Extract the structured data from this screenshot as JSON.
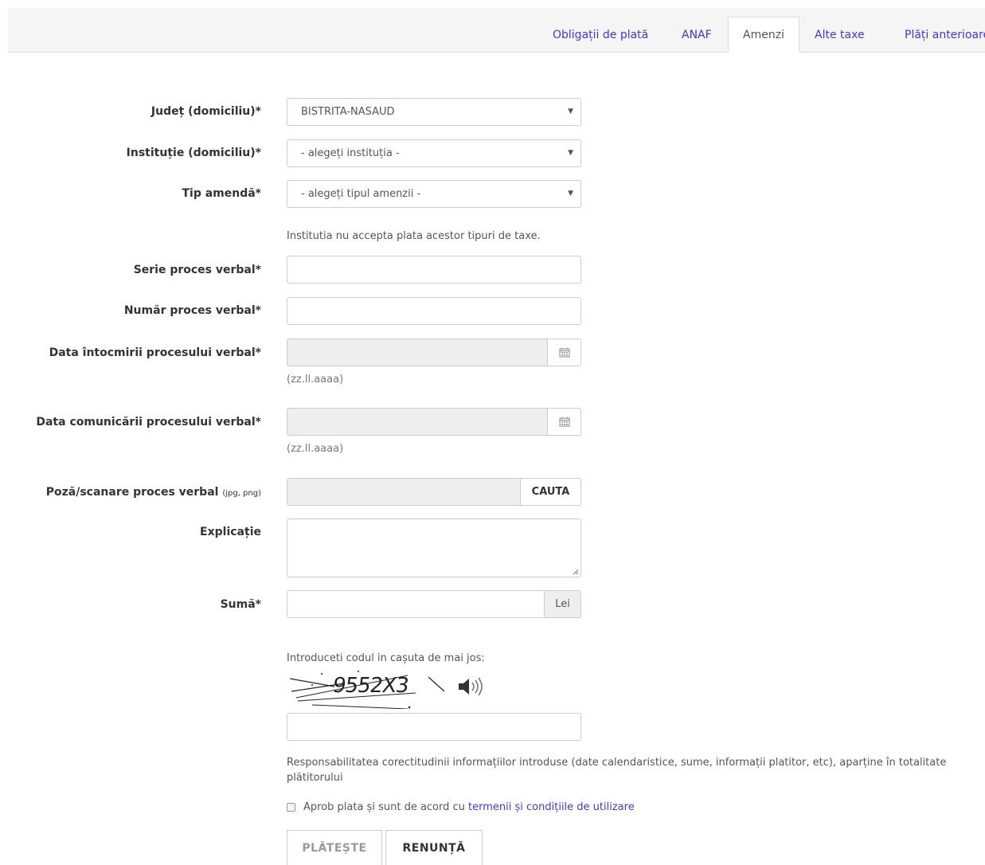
{
  "tabs": [
    {
      "label": "Obligații de plată"
    },
    {
      "label": "ANAF"
    },
    {
      "label": "Amenzi"
    },
    {
      "label": "Alte taxe"
    },
    {
      "label": "Plăți anterioare"
    }
  ],
  "form": {
    "judet_label": "Județ (domiciliu)*",
    "judet_value": "BISTRITA-NASAUD",
    "institutie_label": "Instituție (domiciliu)*",
    "institutie_value": "- alegeți instituția -",
    "tip_label": "Tip amendă*",
    "tip_value": "- alegeți tipul amenzii -",
    "warning": "Institutia nu accepta plata acestor tipuri de taxe.",
    "serie_label": "Serie proces verbal*",
    "numar_label": "Număr proces verbal*",
    "data_intocmirii_label": "Data întocmirii procesului verbal*",
    "data_comunicarii_label": "Data comunicării procesului verbal*",
    "date_format_hint": "(zz.ll.aaaa)",
    "poza_label": "Poză/scanare proces verbal",
    "poza_formats": "(jpg, png)",
    "browse_label": "CAUTA",
    "explicatie_label": "Explicație",
    "suma_label": "Sumă*",
    "currency": "Lei"
  },
  "captcha": {
    "prompt": "Introduceti codul in cașuta de mai jos:",
    "code": "9552X3"
  },
  "disclaimer": "Responsabilitatea corectitudinii informațiilor introduse (date calendaristice, sume, informații platitor, etc), aparține în totalitate plătitorului",
  "terms": {
    "text": "Aprob plata și sunt de acord cu ",
    "link": "termenii și condițiile de utilizare"
  },
  "buttons": {
    "pay": "PLĂTEȘTE",
    "cancel": "RENUNȚĂ"
  },
  "colors": {
    "link": "#3a3ae0",
    "disabled_bg": "#eeeeee"
  }
}
